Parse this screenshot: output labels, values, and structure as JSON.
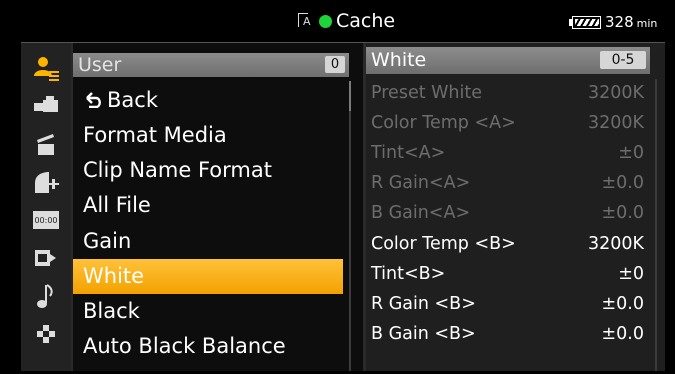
{
  "status_bar": {
    "media_icon": "media-slot-icon",
    "media_letter": "A",
    "recording_indicator_color": "#1fd33a",
    "cache_label": "Cache",
    "battery_icon": "battery-icon",
    "remaining_value": "328",
    "remaining_unit": "min"
  },
  "categories": [
    {
      "icon": "user-menu-icon",
      "active": true
    },
    {
      "icon": "camera-icon",
      "active": false
    },
    {
      "icon": "clapper-icon",
      "active": false
    },
    {
      "icon": "lens-icon",
      "active": false
    },
    {
      "icon": "timecode-icon",
      "active": false
    },
    {
      "icon": "output-icon",
      "active": false
    },
    {
      "icon": "audio-note-icon",
      "active": false
    },
    {
      "icon": "maintenance-icon",
      "active": false
    }
  ],
  "menu": {
    "title": "User",
    "page_badge": "0",
    "items": [
      {
        "label": "Back",
        "icon": "back-arrow-icon"
      },
      {
        "label": "Format Media"
      },
      {
        "label": "Clip Name Format"
      },
      {
        "label": "All File"
      },
      {
        "label": "Gain"
      },
      {
        "label": "White",
        "selected": true
      },
      {
        "label": "Black"
      },
      {
        "label": "Auto Black Balance"
      }
    ]
  },
  "detail": {
    "title": "White",
    "range_badge": "0-5",
    "params": [
      {
        "name": "Preset White",
        "value": "3200K",
        "enabled": false
      },
      {
        "name": "Color Temp <A>",
        "value": "3200K",
        "enabled": false
      },
      {
        "name": "Tint<A>",
        "value": "±0",
        "enabled": false
      },
      {
        "name": "R Gain<A>",
        "value": "±0.0",
        "enabled": false
      },
      {
        "name": "B Gain<A>",
        "value": "±0.0",
        "enabled": false
      },
      {
        "name": "Color Temp <B>",
        "value": "3200K",
        "enabled": true
      },
      {
        "name": "Tint<B>",
        "value": "±0",
        "enabled": true
      },
      {
        "name": "R Gain <B>",
        "value": "±0.0",
        "enabled": true
      },
      {
        "name": "B Gain <B>",
        "value": "±0.0",
        "enabled": true
      }
    ]
  },
  "colors": {
    "accent": "#ffb400",
    "selected_row": "#f6a800",
    "disabled_text": "#6d6d6d"
  }
}
